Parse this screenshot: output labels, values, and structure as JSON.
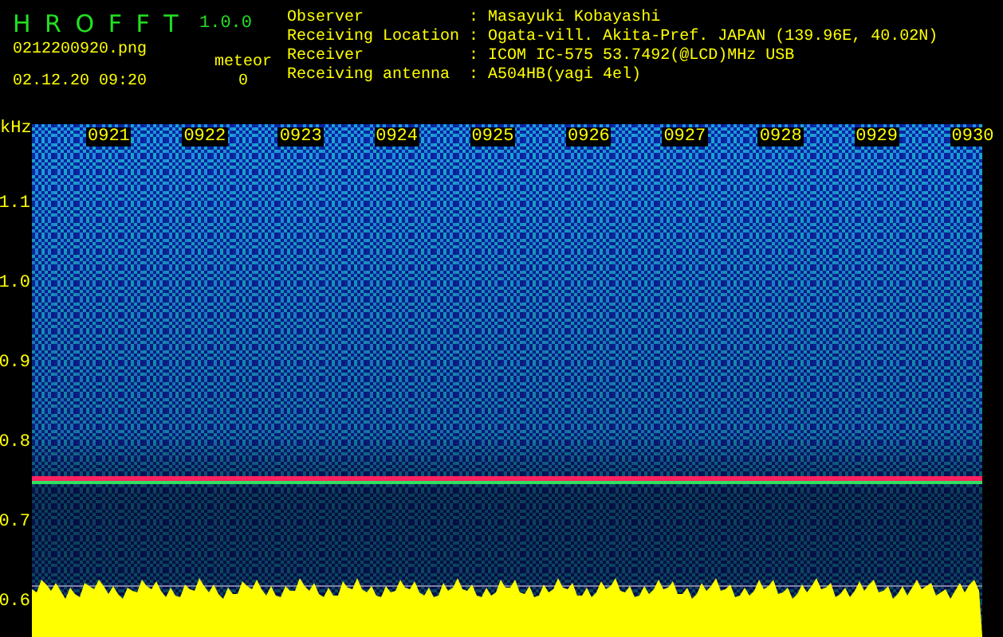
{
  "header": {
    "app_name": "H R O F F T",
    "version": "1.0.0",
    "filename": "0212200920.png",
    "datetime": "02.12.20 09:20",
    "meteor_label": "meteor",
    "meteor_count": "0"
  },
  "info": [
    {
      "label": "Observer",
      "colon": ":",
      "value": "Masayuki Kobayashi"
    },
    {
      "label": "Receiving Location",
      "colon": ":",
      "value": "Ogata-vill. Akita-Pref. JAPAN (139.96E, 40.02N)"
    },
    {
      "label": "Receiver",
      "colon": ":",
      "value": "ICOM IC-575 53.7492(@LCD)MHz USB"
    },
    {
      "label": "Receiving antenna",
      "colon": ":",
      "value": "A504HB(yagi 4el)"
    }
  ],
  "spectrogram": {
    "unit": "kHz",
    "y_labels": [
      "1.1",
      "1.0",
      "0.9",
      "0.8",
      "0.7",
      "0.6"
    ],
    "time_labels": [
      "0921",
      "0922",
      "0923",
      "0924",
      "0925",
      "0926",
      "0927",
      "0928",
      "0929",
      "0930"
    ]
  }
}
